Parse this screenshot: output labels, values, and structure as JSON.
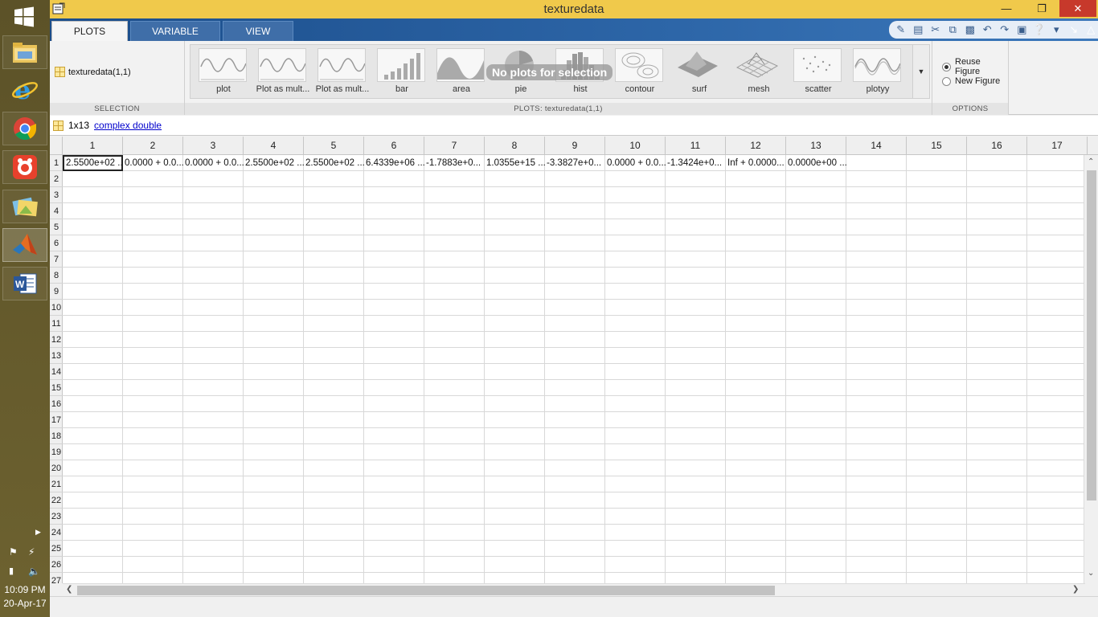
{
  "window": {
    "title": "texturedata"
  },
  "ribbon_tabs": [
    {
      "label": "PLOTS",
      "active": true
    },
    {
      "label": "VARIABLE",
      "active": false
    },
    {
      "label": "VIEW",
      "active": false
    }
  ],
  "selection": {
    "variable": "texturedata(1,1)",
    "section_label": "SELECTION"
  },
  "plots": {
    "section_label": "PLOTS: texturedata(1,1)",
    "no_plots_message": "No plots for selection",
    "items": [
      {
        "label": "plot",
        "icon": "line-plot-icon"
      },
      {
        "label": "Plot as mult...",
        "icon": "multi-line-plot-icon"
      },
      {
        "label": "Plot as mult...",
        "icon": "multi-line-plot-icon"
      },
      {
        "label": "bar",
        "icon": "bar-plot-icon"
      },
      {
        "label": "area",
        "icon": "area-plot-icon"
      },
      {
        "label": "pie",
        "icon": "pie-plot-icon"
      },
      {
        "label": "hist",
        "icon": "histogram-icon"
      },
      {
        "label": "contour",
        "icon": "contour-plot-icon"
      },
      {
        "label": "surf",
        "icon": "surface-plot-icon"
      },
      {
        "label": "mesh",
        "icon": "mesh-plot-icon"
      },
      {
        "label": "scatter",
        "icon": "scatter-plot-icon"
      },
      {
        "label": "plotyy",
        "icon": "plotyy-icon"
      }
    ]
  },
  "options": {
    "section_label": "OPTIONS",
    "reuse_label": "Reuse Figure",
    "new_label": "New Figure",
    "selected": "reuse"
  },
  "info": {
    "size": "1x13",
    "type_link": "complex double"
  },
  "grid": {
    "columns": [
      "1",
      "2",
      "3",
      "4",
      "5",
      "6",
      "7",
      "8",
      "9",
      "10",
      "11",
      "12",
      "13",
      "14",
      "15",
      "16",
      "17"
    ],
    "rows": [
      "1",
      "2",
      "3",
      "4",
      "5",
      "6",
      "7",
      "8",
      "9",
      "10",
      "11",
      "12",
      "13",
      "14",
      "15",
      "16",
      "17",
      "18",
      "19",
      "20",
      "21",
      "22",
      "23",
      "24",
      "25",
      "26",
      "27"
    ],
    "row1": [
      "2.5500e+02 ...",
      "0.0000 + 0.0...",
      "0.0000 + 0.0...",
      "2.5500e+02 ...",
      "2.5500e+02 ...",
      "6.4339e+06 ...",
      " -1.7883e+0...",
      "1.0355e+15 ...",
      " -3.3827e+0...",
      "0.0000 + 0.0...",
      " -1.3424e+0...",
      "Inf + 0.0000...",
      "0.0000e+00 ..."
    ]
  },
  "taskbar": {
    "apps": [
      "file-explorer-icon",
      "internet-explorer-icon",
      "chrome-icon",
      "screen-recorder-icon",
      "photos-icon",
      "matlab-icon",
      "word-icon"
    ],
    "time": "10:09 PM",
    "date": "20-Apr-17"
  },
  "colors": {
    "titlebar": "#f0c94b",
    "tabstrip": "#2d66a8",
    "close": "#c7392b",
    "taskbar": "#6b5f2a",
    "link": "#0000cc"
  }
}
